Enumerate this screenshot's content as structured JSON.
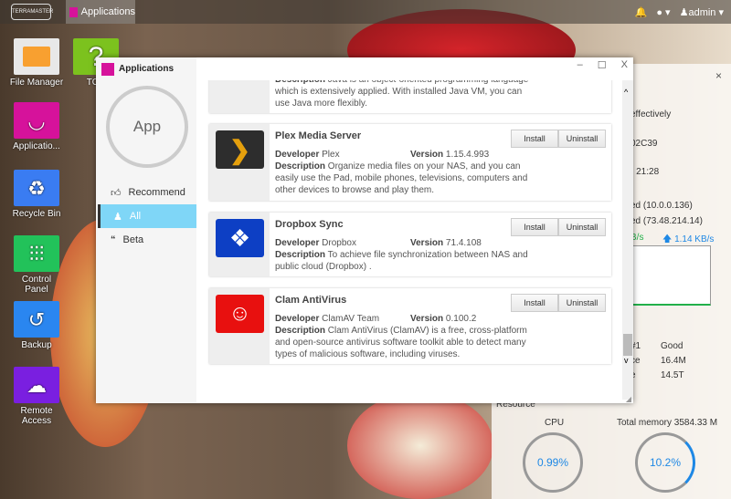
{
  "topbar": {
    "logo": "TERRAMASTER",
    "active_app": "Applications",
    "user": "admin"
  },
  "desktop": [
    {
      "label": "File Manager",
      "color": "#e8e8e8"
    },
    {
      "label": "TOS",
      "color": "#7cc21e"
    },
    {
      "label": "Applicatio...",
      "color": "#d6129b"
    },
    {
      "label": "Recycle Bin",
      "color": "#3a7cf2"
    },
    {
      "label": "Control Panel",
      "color": "#22c25a"
    },
    {
      "label": "Backup",
      "color": "#2a86f0"
    },
    {
      "label": "Remote Access",
      "color": "#7a1fe0"
    }
  ],
  "window": {
    "title": "Applications",
    "logo": "App",
    "nav": [
      {
        "label": "Recommend",
        "icon": "thumbs-up-icon"
      },
      {
        "label": "All",
        "icon": "user-icon",
        "active": true
      },
      {
        "label": "Beta",
        "icon": "quote-icon"
      }
    ],
    "labels": {
      "developer": "Developer",
      "version": "Version",
      "description": "Description",
      "install": "Install",
      "uninstall": "Uninstall"
    },
    "partial_description": "Java is an object-oriented programming language which is extensively applied. With installed Java VM, you can use Java more flexibly.",
    "apps": [
      {
        "name": "Plex Media Server",
        "developer": "Plex",
        "version": "1.15.4.993",
        "description": "Organize media files on your NAS, and you can easily use the Pad, mobile phones, televisions, computers and other devices to browse and play them."
      },
      {
        "name": "Dropbox Sync",
        "developer": "Dropbox",
        "version": "71.4.108",
        "description": "To achieve file synchronization between NAS and public cloud (Dropbox) ."
      },
      {
        "name": "Clam AntiVirus",
        "developer": "ClamAV Team",
        "version": "0.100.2",
        "description": "Clam AntiVirus (ClamAV) is a free, cross-platform and open-source antivirus software toolkit able to detect many types of malicious software, including viruses."
      }
    ]
  },
  "widget": {
    "lines": [
      "effectively",
      "02C39",
      ") 21:28",
      "ed (10.0.0.136)",
      "ed (73.48.214.14)"
    ],
    "download": "B/s",
    "upload": "1.14 KB/s",
    "disk": [
      [
        "#1",
        "Good"
      ],
      [
        "ce",
        "16.4M"
      ],
      [
        "e",
        "14.5T"
      ]
    ],
    "resource_title": "Resource",
    "cpu_label": "CPU",
    "cpu_value": "0.99%",
    "cpu_fraction": 0.0099,
    "memory_label": "Total memory 3584.33 M",
    "memory_value": "10.2%",
    "memory_fraction": 0.102
  }
}
